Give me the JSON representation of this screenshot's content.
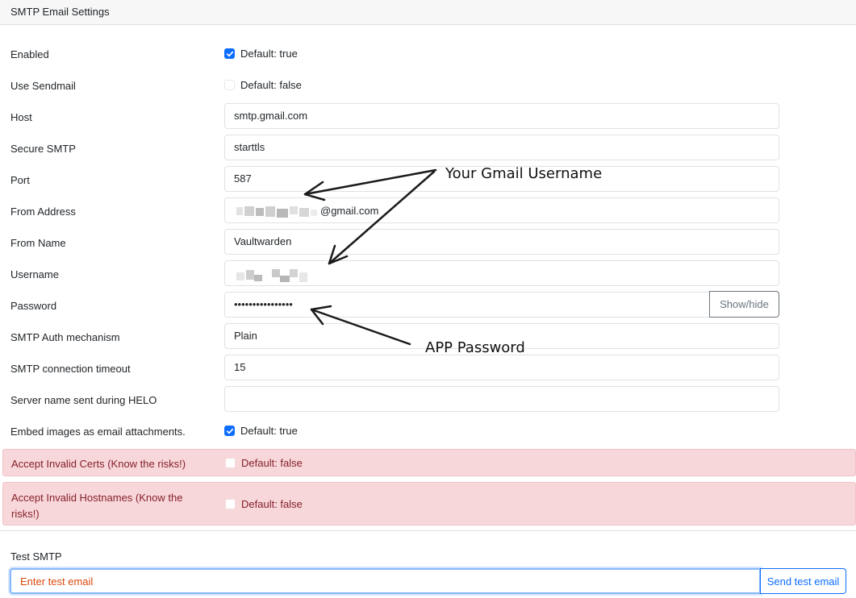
{
  "header": {
    "title": "SMTP Email Settings"
  },
  "fields": {
    "enabled": {
      "label": "Enabled",
      "checked": true,
      "default_text": "Default: true"
    },
    "use_sendmail": {
      "label": "Use Sendmail",
      "checked": false,
      "default_text": "Default: false"
    },
    "host": {
      "label": "Host",
      "value": "smtp.gmail.com"
    },
    "secure_smtp": {
      "label": "Secure SMTP",
      "value": "starttls"
    },
    "port": {
      "label": "Port",
      "value": "587"
    },
    "from_address": {
      "label": "From Address",
      "value_suffix": "@gmail.com"
    },
    "from_name": {
      "label": "From Name",
      "value": "Vaultwarden"
    },
    "username": {
      "label": "Username"
    },
    "password": {
      "label": "Password",
      "masked_value": "••••••••••••••••",
      "toggle_label": "Show/hide"
    },
    "auth_mechanism": {
      "label": "SMTP Auth mechanism",
      "value": "Plain"
    },
    "timeout": {
      "label": "SMTP connection timeout",
      "value": "15"
    },
    "helo_name": {
      "label": "Server name sent during HELO",
      "value": ""
    },
    "embed_images": {
      "label": "Embed images as email attachments.",
      "checked": true,
      "default_text": "Default: true"
    },
    "accept_invalid_certs": {
      "label": "Accept Invalid Certs (Know the risks!)",
      "checked": false,
      "default_text": "Default: false"
    },
    "accept_invalid_hostnames": {
      "label": "Accept Invalid Hostnames (Know the risks!)",
      "checked": false,
      "default_text": "Default: false"
    }
  },
  "test": {
    "label": "Test SMTP",
    "placeholder": "Enter test email",
    "button_label": "Send test email"
  },
  "annotations": {
    "gmail_username": "Your Gmail Username",
    "app_password": "APP Password"
  },
  "colors": {
    "accent": "#0d6efd",
    "danger_bg": "#f8d7da",
    "danger_text": "#842029",
    "placeholder_text": "#d9480f"
  }
}
